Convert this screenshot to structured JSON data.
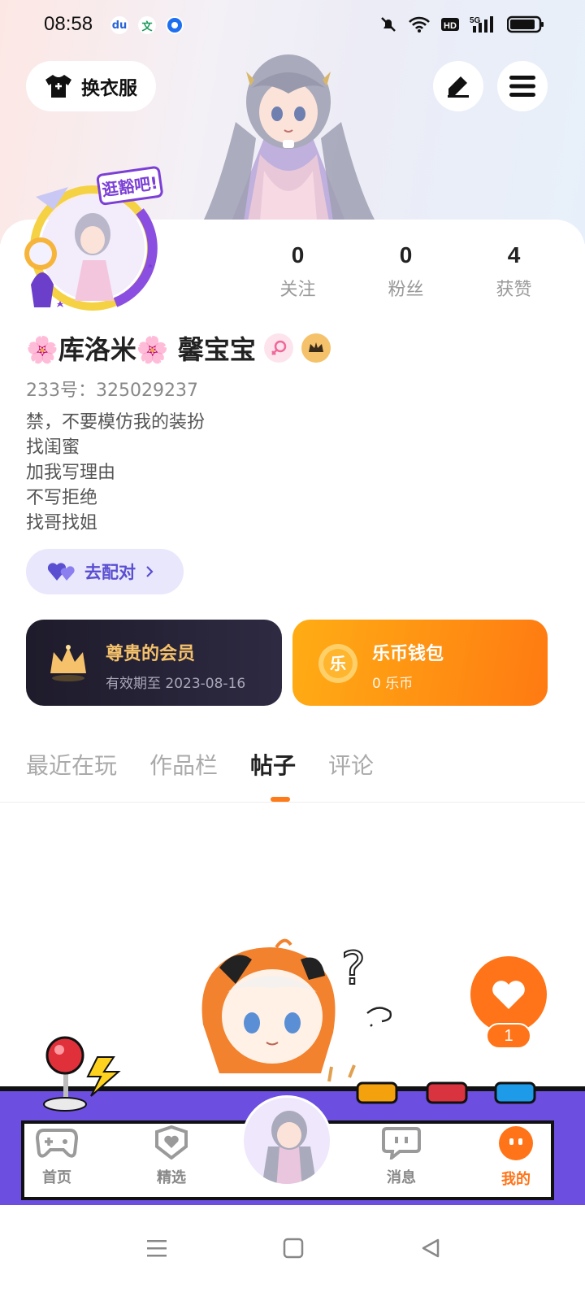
{
  "status_bar": {
    "time": "08:58",
    "apps": [
      {
        "name": "baidu-icon",
        "glyph": "du"
      },
      {
        "name": "wen-icon",
        "glyph": "文"
      },
      {
        "name": "browser-icon",
        "glyph": "●"
      }
    ],
    "network": "5G"
  },
  "header": {
    "outfit_label": "换衣服",
    "edit_icon": "pencil-icon",
    "menu_icon": "hamburger-menu-icon"
  },
  "avatar": {
    "badge_text": "逛豁吧!"
  },
  "stats": [
    {
      "value": "0",
      "label": "关注"
    },
    {
      "value": "0",
      "label": "粉丝"
    },
    {
      "value": "4",
      "label": "获赞"
    }
  ],
  "profile": {
    "username": "🌸库洛米🌸  馨宝宝",
    "gender_icon": "female-icon",
    "vip_icon": "crown-icon",
    "uid": "233号：325029237",
    "bio": [
      "禁，不要模仿我的装扮",
      "找闺蜜",
      "加我写理由",
      "不写拒绝",
      "找哥找姐"
    ]
  },
  "pair_button": {
    "label": "去配对"
  },
  "member_card": {
    "title": "尊贵的会员",
    "subtitle": "有效期至 2023-08-16"
  },
  "wallet_card": {
    "title": "乐币钱包",
    "subtitle": "0 乐币",
    "coin_glyph": "乐"
  },
  "tabs": [
    {
      "label": "最近在玩",
      "active": false
    },
    {
      "label": "作品栏",
      "active": false
    },
    {
      "label": "帖子",
      "active": true
    },
    {
      "label": "评论",
      "active": false
    }
  ],
  "like": {
    "count": "1"
  },
  "nav": [
    {
      "label": "首页",
      "icon": "gamepad-icon",
      "active": false
    },
    {
      "label": "精选",
      "icon": "heart-box-icon",
      "active": false
    },
    {
      "label": "消息",
      "icon": "message-icon",
      "active": false
    },
    {
      "label": "我的",
      "icon": "profile-face-icon",
      "active": true
    }
  ],
  "colors": {
    "accent": "#ff7418",
    "nav_purple": "#6c4ee0",
    "pair_purple": "#5a4fd1",
    "gold": "#f5c26b"
  }
}
